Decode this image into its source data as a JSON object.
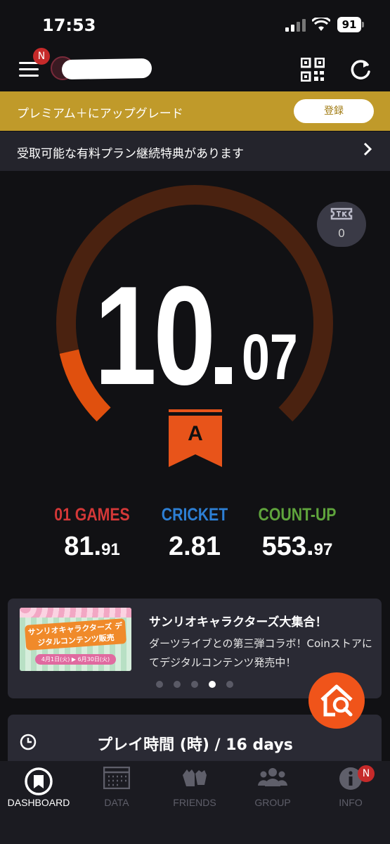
{
  "status_bar": {
    "time": "17:53",
    "battery": "91"
  },
  "header": {
    "menu_badge": "N"
  },
  "upgrade_banner": {
    "label": "プレミアム＋にアップグレード",
    "button": "登録"
  },
  "benefit_banner": {
    "label": "受取可能な有料プラン継続特典があります"
  },
  "rating": {
    "integer": "10",
    "decimal": "07",
    "class": "A",
    "gauge_fraction": 0.12,
    "ticket_count": "0",
    "colors": {
      "track": "#4a2210",
      "fill": "#e0500e"
    }
  },
  "stats": [
    {
      "label": "01 GAMES",
      "int": "81.",
      "dec": "91",
      "color": "#d43838"
    },
    {
      "label": "CRICKET",
      "int": "2.81",
      "dec": "",
      "color": "#2d7fd4"
    },
    {
      "label": "COUNT-UP",
      "int": "553.",
      "dec": "97",
      "color": "#5fa43c"
    }
  ],
  "news": {
    "title": "サンリオキャラクターズ大集合！",
    "body": "ダーツライブとの第三弾コラボ！Coinストアにてデジタルコンテンツ発売中！",
    "thumb_title": "サンリオキャラクターズ デジタルコンテンツ販売",
    "thumb_dates": "4月1日(火) ▶ 6月30日(火)",
    "active_dot": 3
  },
  "playtime": {
    "label": "プレイ時間 (時) / 16 days"
  },
  "nav": [
    {
      "label": "DASHBOARD",
      "icon": "dashboard-icon",
      "active": true
    },
    {
      "label": "DATA",
      "icon": "data-icon",
      "active": false
    },
    {
      "label": "FRIENDS",
      "icon": "friends-icon",
      "active": false
    },
    {
      "label": "GROUP",
      "icon": "group-icon",
      "active": false
    },
    {
      "label": "INFO",
      "icon": "info-icon",
      "active": false,
      "badge": "N"
    }
  ]
}
